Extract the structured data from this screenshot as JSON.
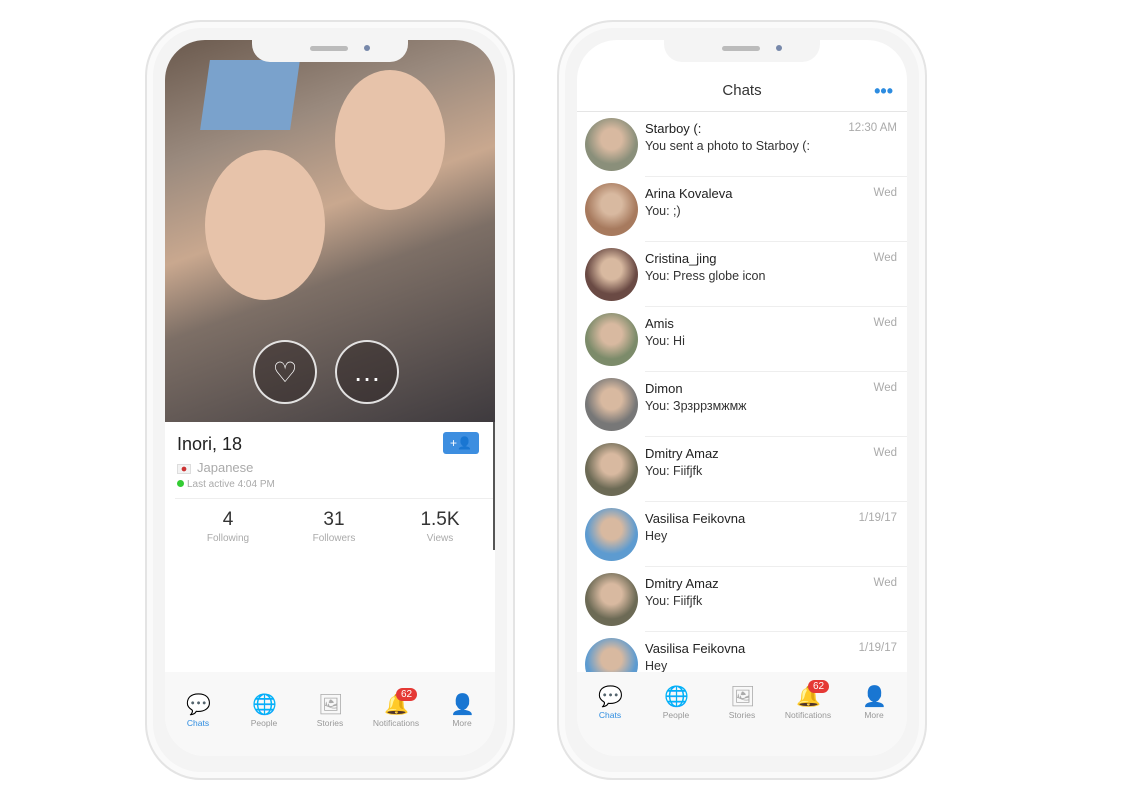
{
  "profile_phone": {
    "name": "Inori, 18",
    "language": "Japanese",
    "last_active": "Last active 4:04 PM",
    "add_friend_icon": "+👤",
    "stats": [
      {
        "value": "4",
        "label": "Following"
      },
      {
        "value": "31",
        "label": "Followers"
      },
      {
        "value": "1.5K",
        "label": "Views"
      }
    ],
    "like_icon": "♡",
    "chat_icon": "…"
  },
  "tabs": [
    {
      "label": "Chats",
      "icon": "💬"
    },
    {
      "label": "People",
      "icon": "🌐"
    },
    {
      "label": "Stories",
      "icon": "🖼"
    },
    {
      "label": "Notifications",
      "icon": "🔔",
      "badge": "62"
    },
    {
      "label": "More",
      "icon": "👤"
    }
  ],
  "chats_phone": {
    "title": "Chats",
    "more": "•••",
    "chats": [
      {
        "name": "Starboy (:",
        "message": "You sent a photo to Starboy (:",
        "time": "12:30 AM",
        "color": "#8a8f7a"
      },
      {
        "name": "Arina Kovaleva",
        "message": "You: ;)",
        "time": "Wed",
        "color": "#a77a5e"
      },
      {
        "name": "Cristina_jing",
        "message": "You: Press globe icon",
        "time": "Wed",
        "color": "#6a4a44"
      },
      {
        "name": "Amis",
        "message": "You: Hi",
        "time": "Wed",
        "color": "#7c8b6a"
      },
      {
        "name": "Dimon",
        "message": "You: Зрзррзмжмж",
        "time": "Wed",
        "color": "#777"
      },
      {
        "name": "Dmitry Amaz",
        "message": "You: Fiifjfk",
        "time": "Wed",
        "color": "#6c6a55"
      },
      {
        "name": "Vasilisa Feikovna",
        "message": "Hey",
        "time": "1/19/17",
        "color": "#5d9bd0"
      },
      {
        "name": "Dmitry Amaz",
        "message": "You: Fiifjfk",
        "time": "Wed",
        "color": "#6c6a55"
      },
      {
        "name": "Vasilisa Feikovna",
        "message": "Hey",
        "time": "1/19/17",
        "color": "#5d9bd0"
      }
    ]
  }
}
